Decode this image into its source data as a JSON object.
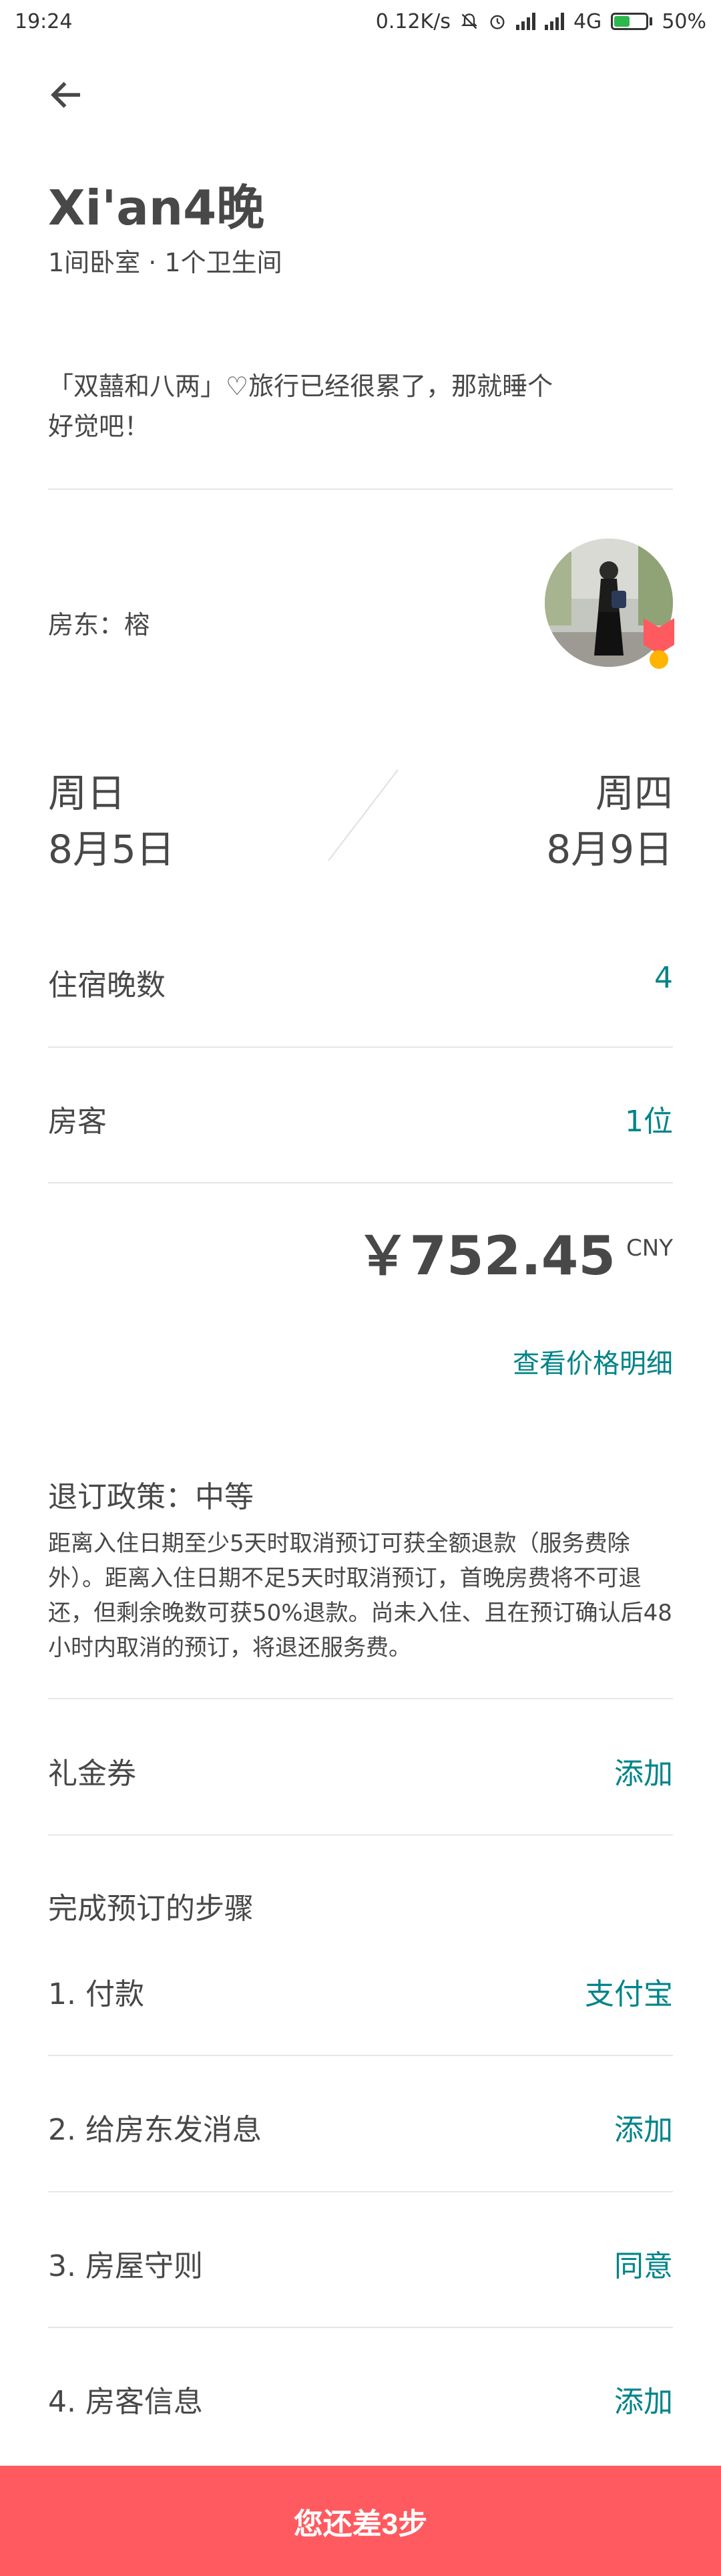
{
  "status_bar": {
    "time": "19:24",
    "net_speed": "0.12K/s",
    "network": "4G",
    "battery": "50%",
    "battery_level": 0.5,
    "battery_color": "#2db84d"
  },
  "header": {
    "title": "Xi'an4晚",
    "subtitle": "1间卧室 · 1个卫生间"
  },
  "listing": {
    "description": "「双囍和八两」♡旅行已经很累了，那就睡个好觉吧！"
  },
  "host": {
    "label": "房东：榕"
  },
  "dates": {
    "checkin_weekday": "周日",
    "checkin_date": "8月5日",
    "checkout_weekday": "周四",
    "checkout_date": "8月9日"
  },
  "details": {
    "nights_label": "住宿晚数",
    "nights_value": "4",
    "guests_label": "房客",
    "guests_value": "1位"
  },
  "price": {
    "amount": "￥752.45",
    "currency": "CNY",
    "details_link": "查看价格明细"
  },
  "policy": {
    "title": "退订政策：中等",
    "body": "距离入住日期至少5天时取消预订可获全额退款（服务费除外）。距离入住日期不足5天时取消预订，首晚房费将不可退还，但剩余晚数可获50%退款。尚未入住、且在预订确认后48小时内取消的预订，将退还服务费。"
  },
  "coupon": {
    "label": "礼金券",
    "action": "添加"
  },
  "steps": {
    "title": "完成预订的步骤",
    "items": [
      {
        "label": "1. 付款",
        "action": "支付宝"
      },
      {
        "label": "2. 给房东发消息",
        "action": "添加"
      },
      {
        "label": "3. 房屋守则",
        "action": "同意"
      },
      {
        "label": "4. 房客信息",
        "action": "添加"
      }
    ]
  },
  "footer": {
    "button_label": "您还差3步"
  },
  "colors": {
    "accent": "#008489",
    "primary_button": "#ff5a5f",
    "text": "#484848",
    "divider": "#e6e6e6"
  }
}
